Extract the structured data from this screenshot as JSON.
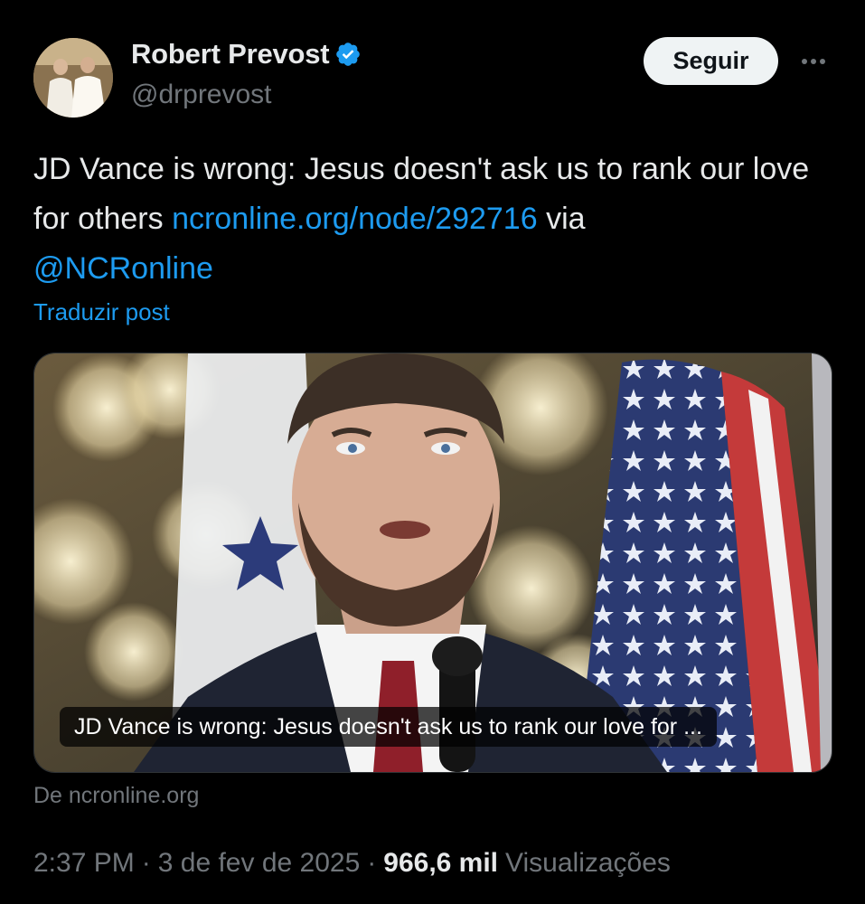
{
  "author": {
    "display_name": "Robert Prevost",
    "handle": "@drprevost",
    "verified": true
  },
  "actions": {
    "follow_label": "Seguir",
    "more_icon": "more-horizontal-icon"
  },
  "post": {
    "text_before_link": "JD Vance is wrong: Jesus doesn't ask us to rank our love for others ",
    "link_text": "ncronline.org/node/292716",
    "text_after_link": " via ",
    "mention": "@NCRonline",
    "translate_label": "Traduzir post"
  },
  "card": {
    "title": "JD Vance is wrong: Jesus doesn't ask us to rank our love for ...",
    "source": "De ncronline.org"
  },
  "meta": {
    "time": "2:37 PM",
    "date": "3 de fev de 2025",
    "separator": "·",
    "views_count": "966,6 mil",
    "views_label": "Visualizações"
  },
  "colors": {
    "background": "#000000",
    "text": "#e7e9ea",
    "secondary": "#71767b",
    "link": "#1d9bf0",
    "verified_badge": "#1d9bf0",
    "follow_button_bg": "#eff3f4"
  }
}
